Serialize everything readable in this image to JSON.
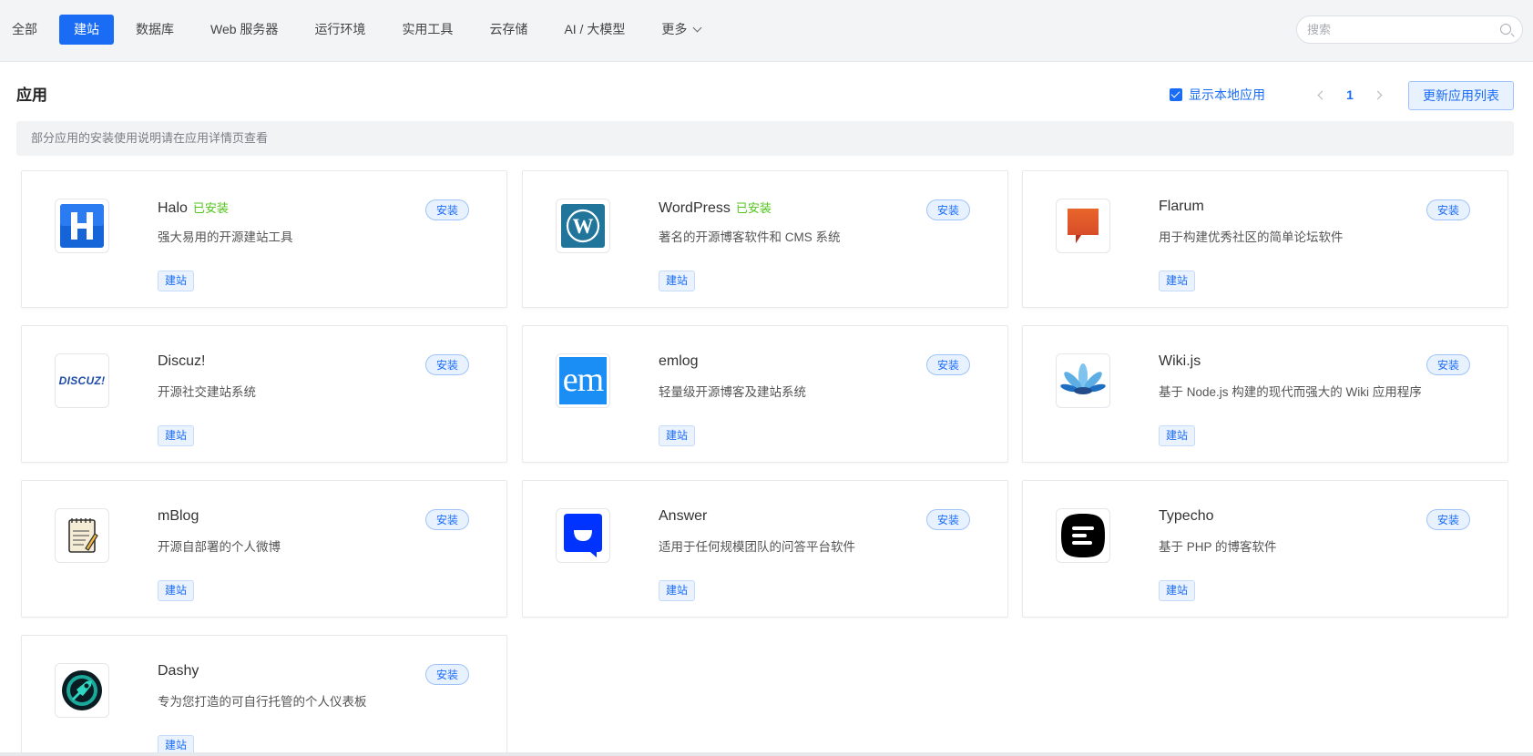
{
  "nav": {
    "tabs": [
      {
        "label": "全部"
      },
      {
        "label": "建站"
      },
      {
        "label": "数据库"
      },
      {
        "label": "Web 服务器"
      },
      {
        "label": "运行环境"
      },
      {
        "label": "实用工具"
      },
      {
        "label": "云存储"
      },
      {
        "label": "AI / 大模型"
      },
      {
        "label": "更多"
      }
    ],
    "active_tab": "建站",
    "search_placeholder": "搜索"
  },
  "panel": {
    "title": "应用",
    "show_local_label": "显示本地应用",
    "show_local_checked": true,
    "current_page": "1",
    "refresh_label": "更新应用列表",
    "notice": "部分应用的安装使用说明请在应用详情页查看"
  },
  "apps": [
    {
      "name": "Halo",
      "installed_label": "已安装",
      "desc": "强大易用的开源建站工具",
      "install_label": "安装",
      "tag": "建站",
      "icon": "halo-logo-icon"
    },
    {
      "name": "WordPress",
      "installed_label": "已安装",
      "desc": "著名的开源博客软件和 CMS 系统",
      "install_label": "安装",
      "tag": "建站",
      "icon": "wordpress-logo-icon"
    },
    {
      "name": "Flarum",
      "installed_label": "",
      "desc": "用于构建优秀社区的简单论坛软件",
      "install_label": "安装",
      "tag": "建站",
      "icon": "flarum-logo-icon"
    },
    {
      "name": "Discuz!",
      "installed_label": "",
      "desc": "开源社交建站系统",
      "install_label": "安装",
      "tag": "建站",
      "icon": "discuz-logo-icon",
      "logo_text": "DISCUZ!"
    },
    {
      "name": "emlog",
      "installed_label": "",
      "desc": "轻量级开源博客及建站系统",
      "install_label": "安装",
      "tag": "建站",
      "icon": "emlog-logo-icon",
      "logo_text": "em"
    },
    {
      "name": "Wiki.js",
      "installed_label": "",
      "desc": "基于 Node.js 构建的现代而强大的 Wiki 应用程序",
      "install_label": "安装",
      "tag": "建站",
      "icon": "wikijs-logo-icon"
    },
    {
      "name": "mBlog",
      "installed_label": "",
      "desc": "开源自部署的个人微博",
      "install_label": "安装",
      "tag": "建站",
      "icon": "mblog-logo-icon"
    },
    {
      "name": "Answer",
      "installed_label": "",
      "desc": "适用于任何规模团队的问答平台软件",
      "install_label": "安装",
      "tag": "建站",
      "icon": "answer-logo-icon"
    },
    {
      "name": "Typecho",
      "installed_label": "",
      "desc": "基于 PHP 的博客软件",
      "install_label": "安装",
      "tag": "建站",
      "icon": "typecho-logo-icon"
    },
    {
      "name": "Dashy",
      "installed_label": "",
      "desc": "专为您打造的可自行托管的个人仪表板",
      "install_label": "安装",
      "tag": "建站",
      "icon": "dashy-logo-icon"
    }
  ],
  "colors": {
    "accent": "#1a6cf5",
    "installed": "#52c41a"
  }
}
